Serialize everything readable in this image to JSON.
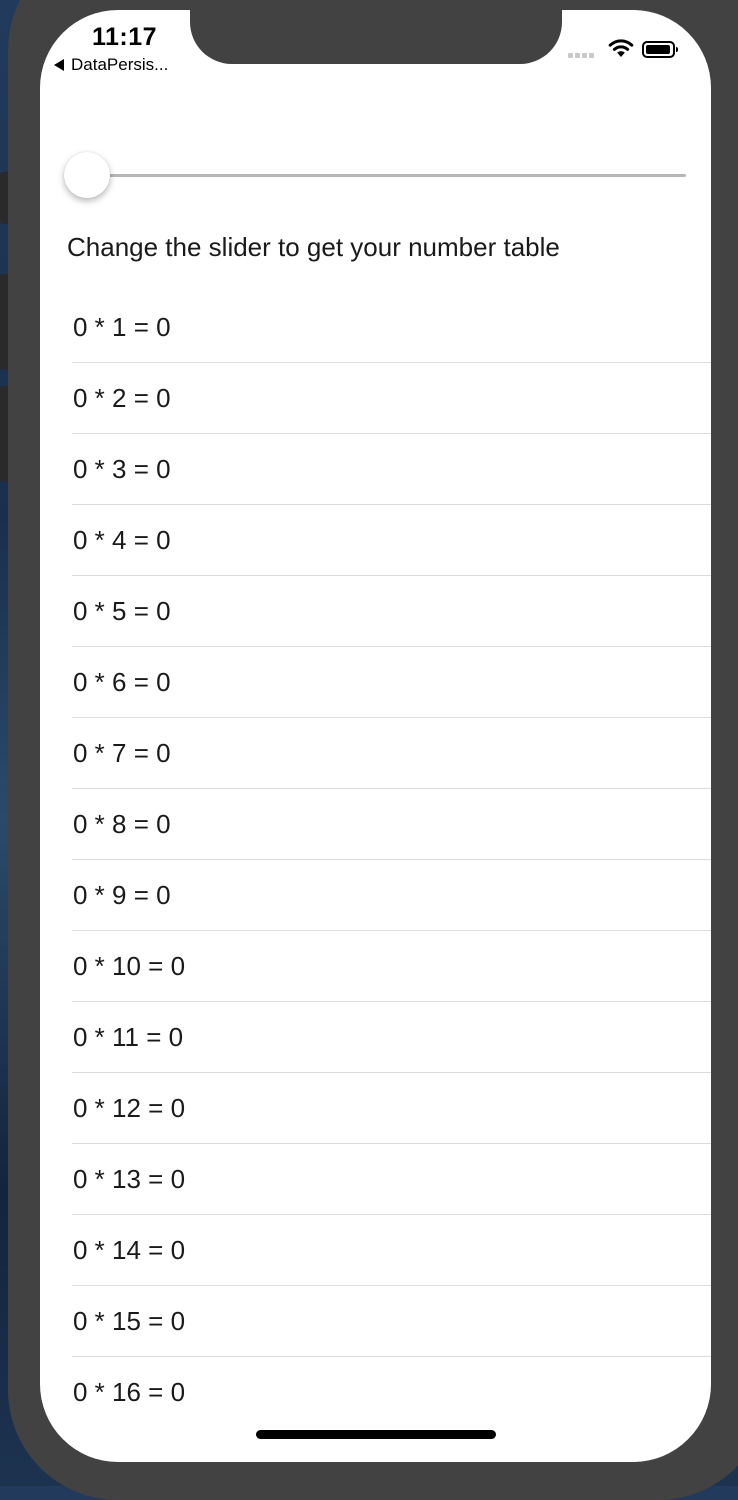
{
  "status_bar": {
    "time": "11:17",
    "back_label": "DataPersis...",
    "icons": [
      "cellular-signal-icon",
      "wifi-icon",
      "battery-icon"
    ]
  },
  "slider": {
    "value": 0,
    "min": 0,
    "max": 1,
    "accent_color": "#007aff"
  },
  "prompt": "Change the slider to get your number table",
  "rows": [
    "0 * 1 = 0",
    "0 * 2 = 0",
    "0 * 3 = 0",
    "0 * 4 = 0",
    "0 * 5 = 0",
    "0 * 6 = 0",
    "0 * 7 = 0",
    "0 * 8 = 0",
    "0 * 9 = 0",
    "0 * 10 = 0",
    "0 * 11 = 0",
    "0 * 12 = 0",
    "0 * 13 = 0",
    "0 * 14 = 0",
    "0 * 15 = 0",
    "0 * 16 = 0"
  ]
}
